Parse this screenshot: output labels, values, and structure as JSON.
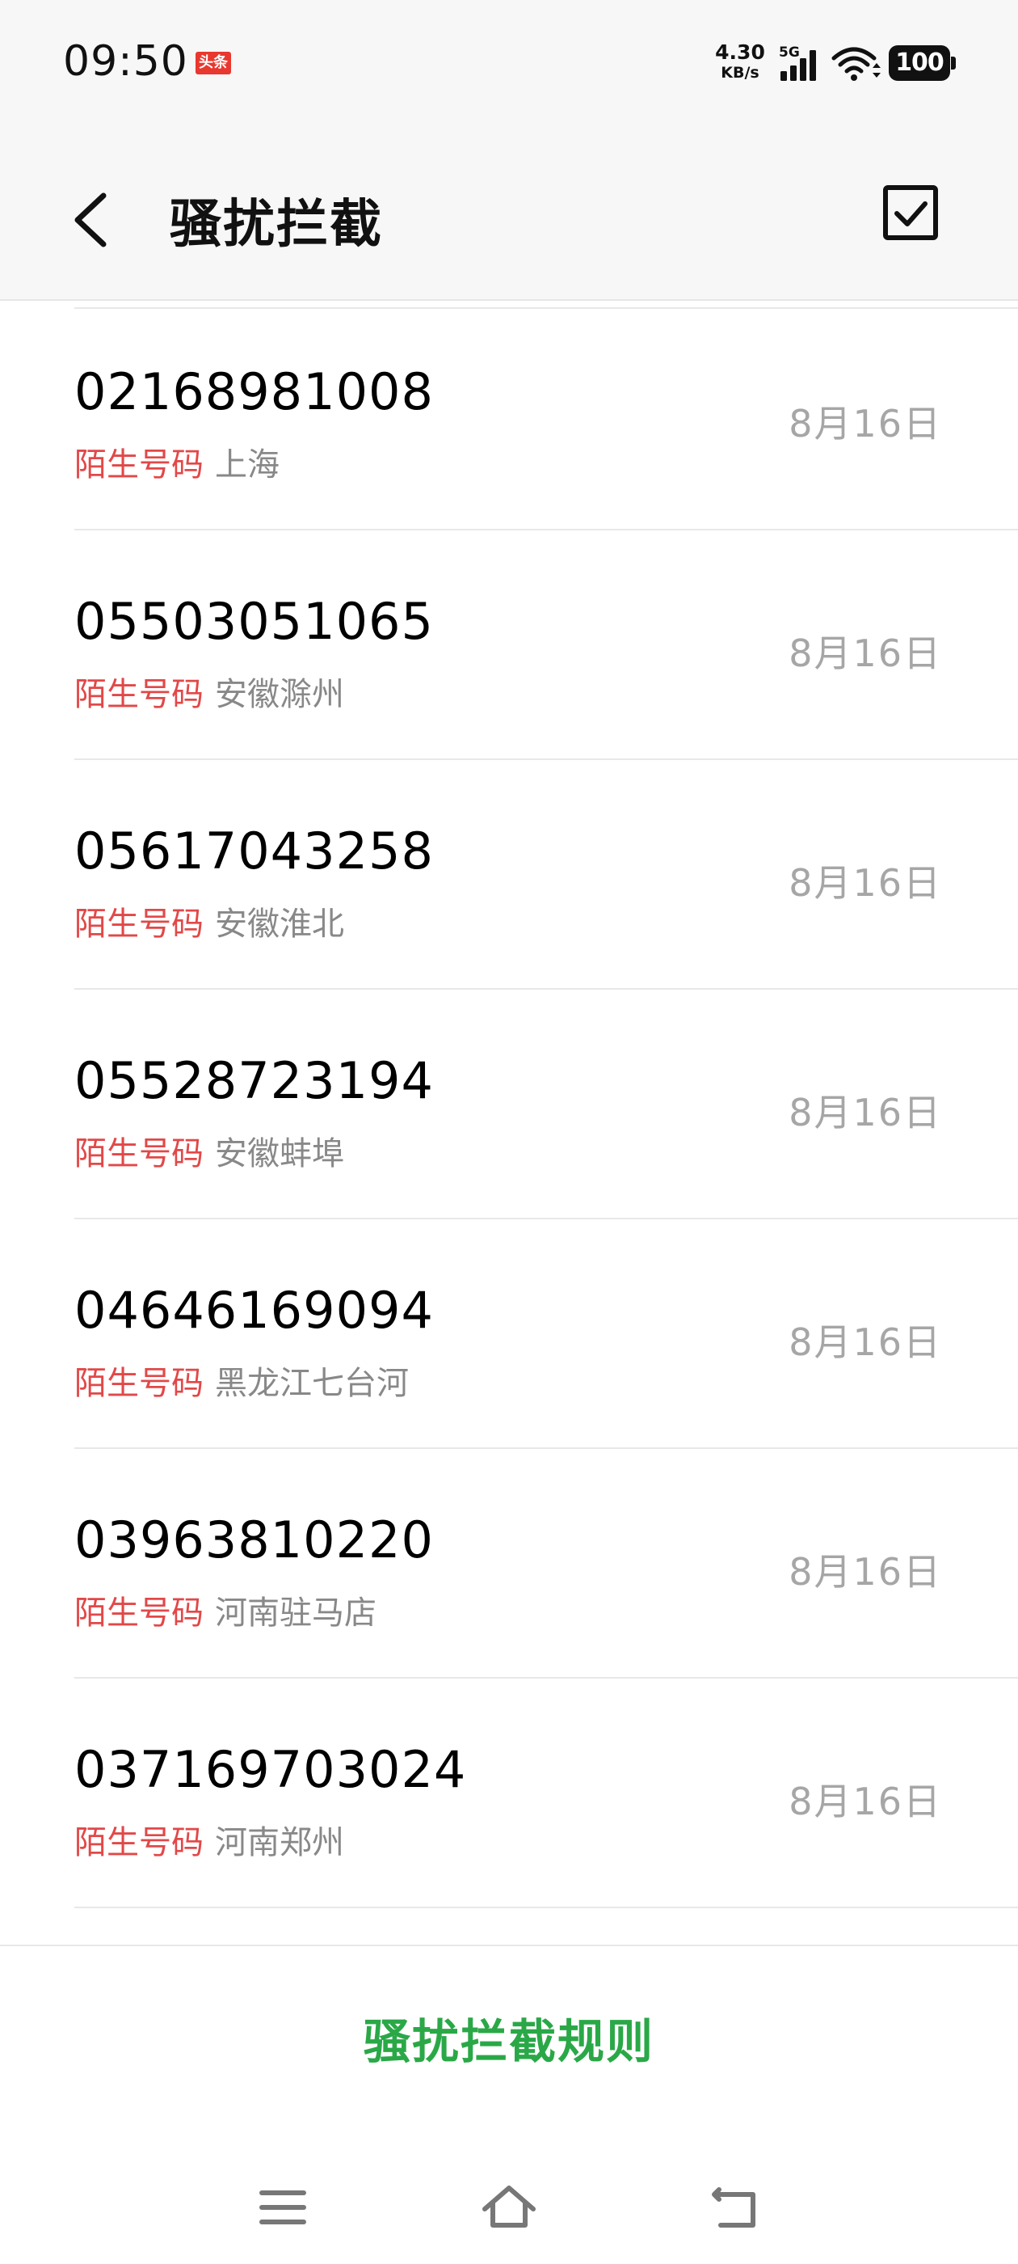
{
  "status_bar": {
    "time": "09:50",
    "notification_badge": "头条",
    "net_speed_value": "4.30",
    "net_speed_unit": "KB/s",
    "network_type": "5G",
    "battery_level": "100"
  },
  "header": {
    "title": "骚扰拦截",
    "back_icon": "chevron-left-icon",
    "select_icon": "checkbox-checked-icon"
  },
  "calls": [
    {
      "number": "02168981008",
      "tag": "陌生号码",
      "location": "上海",
      "date": "8月16日"
    },
    {
      "number": "05503051065",
      "tag": "陌生号码",
      "location": "安徽滁州",
      "date": "8月16日"
    },
    {
      "number": "05617043258",
      "tag": "陌生号码",
      "location": "安徽淮北",
      "date": "8月16日"
    },
    {
      "number": "05528723194",
      "tag": "陌生号码",
      "location": "安徽蚌埠",
      "date": "8月16日"
    },
    {
      "number": "04646169094",
      "tag": "陌生号码",
      "location": "黑龙江七台河",
      "date": "8月16日"
    },
    {
      "number": "03963810220",
      "tag": "陌生号码",
      "location": "河南驻马店",
      "date": "8月16日"
    },
    {
      "number": "037169703024",
      "tag": "陌生号码",
      "location": "河南郑州",
      "date": "8月16日"
    }
  ],
  "footer": {
    "rules_label": "骚扰拦截规则"
  },
  "nav": {
    "menu_icon": "menu-icon",
    "home_icon": "home-icon",
    "back_icon": "back-icon"
  },
  "colors": {
    "stranger_tag": "#e24848",
    "rules_accent": "#2aa847",
    "date_gray": "#a6a6a6"
  }
}
